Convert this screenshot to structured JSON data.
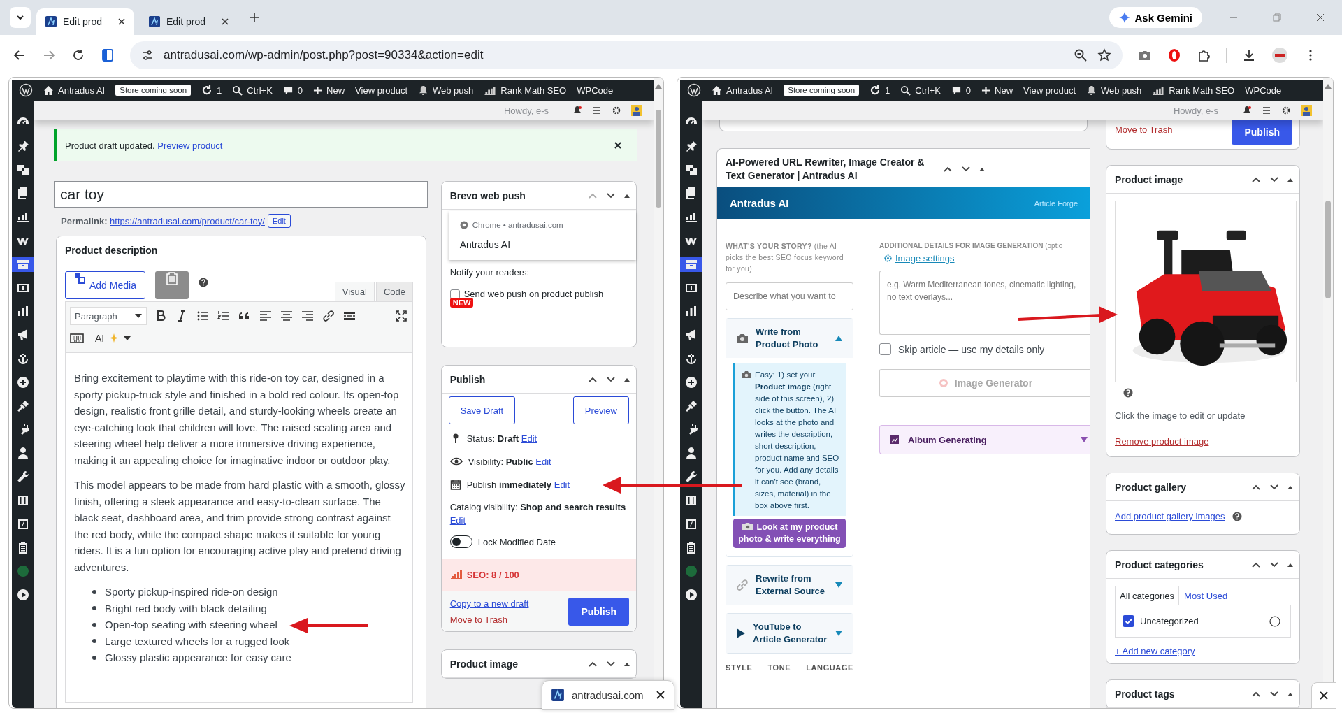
{
  "browser": {
    "tabs": [
      {
        "title": "Edit prod",
        "selected": true
      },
      {
        "title": "Edit prod",
        "selected": false
      }
    ],
    "gemini_button": "Ask Gemini",
    "url": "antradusai.com/wp-admin/post.php?post=90334&action=edit"
  },
  "left_pane": {
    "admin_bar": {
      "site": "Antradus AI",
      "badge": "Store coming soon",
      "updates": "1",
      "search": "Ctrl+K",
      "comments": "0",
      "new": "New",
      "view": "View product",
      "push": "Web push",
      "seo": "Rank Math SEO",
      "wpcode": "WPCode",
      "howdy": "Howdy, e-s"
    },
    "admin_menu": [
      {
        "kind": "dashboard",
        "selected": false
      },
      {
        "kind": "pin",
        "selected": false
      },
      {
        "kind": "media",
        "selected": false
      },
      {
        "kind": "pages",
        "selected": false
      },
      {
        "kind": "chart",
        "selected": false
      },
      {
        "kind": "woo",
        "selected": false
      },
      {
        "kind": "products",
        "selected": true
      },
      {
        "kind": "money",
        "selected": false
      },
      {
        "kind": "bars",
        "selected": false
      },
      {
        "kind": "megaphone",
        "selected": false
      },
      {
        "kind": "anchor",
        "selected": false
      },
      {
        "kind": "plus",
        "selected": false
      },
      {
        "kind": "brush",
        "selected": false
      },
      {
        "kind": "plug",
        "selected": false
      },
      {
        "kind": "user",
        "selected": false
      },
      {
        "kind": "wrench",
        "selected": false
      },
      {
        "kind": "sliders",
        "selected": false
      },
      {
        "kind": "code",
        "selected": false
      },
      {
        "kind": "clipboard",
        "selected": false
      },
      {
        "kind": "badge",
        "selected": false
      },
      {
        "kind": "play",
        "selected": false
      }
    ],
    "notice": {
      "text": "Product draft updated.",
      "link": "Preview product"
    },
    "title": "car toy",
    "permalink": {
      "label": "Permalink:",
      "url": "https://antradusai.com/product/car-toy/",
      "button": "Edit"
    },
    "description": {
      "heading": "Product description",
      "add_media": "Add Media",
      "tabs": [
        {
          "label": "Visual",
          "selected": true
        },
        {
          "label": "Code",
          "selected": false
        }
      ],
      "format": "Paragraph",
      "ai": "AI",
      "paragraphs": [
        "Bring excitement to playtime with this ride-on toy car, designed in a sporty pickup-truck style and finished in a bold red colour. Its open-top design, realistic front grille detail, and sturdy-looking wheels create an eye-catching look that children will love. The raised seating area and steering wheel help deliver a more immersive driving experience, making it an appealing choice for imaginative indoor or outdoor play.",
        "This model appears to be made from hard plastic with a smooth, glossy finish, offering a sleek appearance and easy-to-clean surface. The black seat, dashboard area, and trim provide strong contrast against the red body, while the compact shape makes it suitable for young riders. It is a fun option for encouraging active play and pretend driving adventures."
      ],
      "bullets": [
        "Sporty pickup-inspired ride-on design",
        "Bright red body with black detailing",
        "Open-top seating with steering wheel",
        "Large textured wheels for a rugged look",
        "Glossy plastic appearance for easy care"
      ]
    },
    "brevo": {
      "heading": "Brevo web push",
      "preview_source": "Chrome • antradusai.com",
      "preview_title": "Antradus AI",
      "notify": "Notify your readers:",
      "checkbox": {
        "label": "Send web push on product publish",
        "checked": false
      },
      "new_badge": "NEW"
    },
    "publish": {
      "heading": "Publish",
      "save_draft": "Save Draft",
      "preview": "Preview",
      "rows": [
        {
          "kind": "status",
          "text": "Status: **Draft**",
          "link": "Edit"
        },
        {
          "kind": "visibility",
          "text": "Visibility: **Public**",
          "link": "Edit"
        },
        {
          "kind": "schedule",
          "text": "Publish **immediately**",
          "link": "Edit"
        }
      ],
      "catalog": "Catalog visibility: **Shop and search results**",
      "catalog_link": "Edit",
      "lock": {
        "label": "Lock Modified Date",
        "on": false
      },
      "seo": "SEO: 8 / 100",
      "copy": "Copy to a new draft",
      "trash": "Move to Trash",
      "publish": "Publish"
    },
    "product_image_heading": "Product image"
  },
  "right_pane": {
    "admin_bar": {
      "site": "Antradus AI",
      "badge": "Store coming soon",
      "updates": "1",
      "search": "Ctrl+K",
      "comments": "0",
      "new": "New",
      "view": "View product",
      "push": "Web push",
      "seo": "Rank Math SEO",
      "wpcode": "WPCode",
      "howdy": "Howdy, e-s"
    },
    "admin_menu": [
      {
        "kind": "dashboard",
        "selected": false
      },
      {
        "kind": "pin",
        "selected": false
      },
      {
        "kind": "media",
        "selected": false
      },
      {
        "kind": "pages",
        "selected": false
      },
      {
        "kind": "chart",
        "selected": false
      },
      {
        "kind": "woo",
        "selected": false
      },
      {
        "kind": "products",
        "selected": true
      },
      {
        "kind": "money",
        "selected": false
      },
      {
        "kind": "bars",
        "selected": false
      },
      {
        "kind": "megaphone",
        "selected": false
      },
      {
        "kind": "anchor",
        "selected": false
      },
      {
        "kind": "plus",
        "selected": false
      },
      {
        "kind": "brush",
        "selected": false
      },
      {
        "kind": "plug",
        "selected": false
      },
      {
        "kind": "user",
        "selected": false
      },
      {
        "kind": "wrench",
        "selected": false
      },
      {
        "kind": "sliders",
        "selected": false
      },
      {
        "kind": "code",
        "selected": false
      },
      {
        "kind": "clipboard",
        "selected": false
      },
      {
        "kind": "badge",
        "selected": false
      },
      {
        "kind": "play",
        "selected": false
      }
    ],
    "ai_box": {
      "title": "AI-Powered URL Rewriter, Image Creator & Text Generator | Antradus AI",
      "brand": "Antradus AI",
      "tagline": "Article Forge",
      "story_label": "**WHAT'S YOUR STORY?** (the AI picks the best SEO focus keyword for you)",
      "story_placeholder": "Describe what you want to",
      "sections": [
        {
          "title": "Write from Product Photo",
          "expanded": true,
          "info": "Easy: 1) set your **Product image** (right side of this screen), 2) click the button. The AI looks at the photo and writes the description, short description, product name and SEO for you. Add any details it can't see (brand, sizes, material) in the box above first.",
          "action": "Look at my product photo & write everything"
        },
        {
          "kind": "link",
          "title": "Rewrite from External Source",
          "expanded": false
        },
        {
          "kind": "video",
          "title": "YouTube to Article Generator",
          "expanded": false
        }
      ],
      "options": [
        "STYLE",
        "TONE",
        "LANGUAGE"
      ],
      "details_label": "**ADDITIONAL DETAILS FOR IMAGE GENERATION** (optio",
      "settings_link": "Image settings",
      "details_placeholder": "e.g. Warm Mediterranean tones, cinematic lighting, no text overlays...",
      "skip": {
        "label": "Skip article — use my details only",
        "checked": false
      },
      "generator": {
        "label": "Image Generator",
        "disabled": true
      },
      "album": "Album Generating"
    },
    "sidebar": {
      "trash": "Move to Trash",
      "publish": "Publish",
      "image_heading": "Product image",
      "image_hint": "Click the image to edit or update",
      "remove": "Remove product image",
      "gallery_heading": "Product gallery",
      "gallery_link": "Add product gallery images",
      "categories_heading": "Product categories",
      "category_tabs": [
        {
          "label": "All categories",
          "selected": true
        },
        {
          "label": "Most Used",
          "selected": false
        }
      ],
      "categories": [
        {
          "label": "Uncategorized",
          "checked": true
        }
      ],
      "add_category": "+ Add new category",
      "tags_heading": "Product tags"
    }
  },
  "popup": {
    "site": "antradusai.com"
  }
}
